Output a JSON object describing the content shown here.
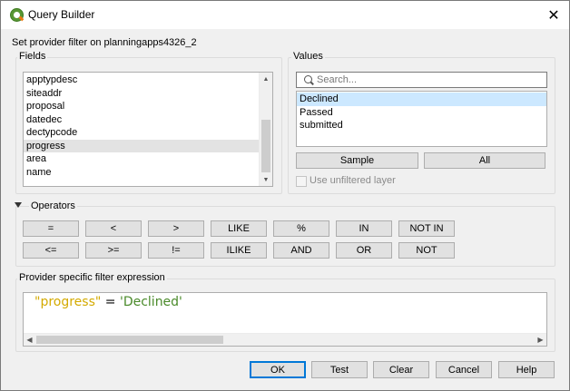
{
  "window": {
    "title": "Query Builder",
    "close_glyph": "✕"
  },
  "provider": {
    "label": "Set provider filter on planningapps4326_2"
  },
  "fields": {
    "group_title": "Fields",
    "items": [
      "apptypdesc",
      "siteaddr",
      "proposal",
      "datedec",
      "dectypcode",
      "progress",
      "area",
      "name"
    ],
    "selected": "progress"
  },
  "values": {
    "group_title": "Values",
    "search_placeholder": "Search...",
    "items": [
      "Declined",
      "Passed",
      "submitted"
    ],
    "selected": "Declined",
    "sample_label": "Sample",
    "all_label": "All",
    "unfiltered_label": "Use unfiltered layer",
    "unfiltered_checked": false
  },
  "operators": {
    "title": "Operators",
    "row1": [
      "=",
      "<",
      ">",
      "LIKE",
      "%",
      "IN",
      "NOT IN"
    ],
    "row2": [
      "<=",
      ">=",
      "!=",
      "ILIKE",
      "AND",
      "OR",
      "NOT"
    ]
  },
  "expression": {
    "title": "Provider specific filter expression",
    "field": "\"progress\"",
    "operator": " = ",
    "value": "'Declined'",
    "colors": {
      "field": "#d4aa00",
      "value": "#4a8a2a"
    }
  },
  "footer": {
    "ok": "OK",
    "test": "Test",
    "clear": "Clear",
    "cancel": "Cancel",
    "help": "Help"
  },
  "icons": {
    "app": "qgis-logo-icon",
    "search": "search-icon",
    "collapse": "triangle-down-icon"
  }
}
